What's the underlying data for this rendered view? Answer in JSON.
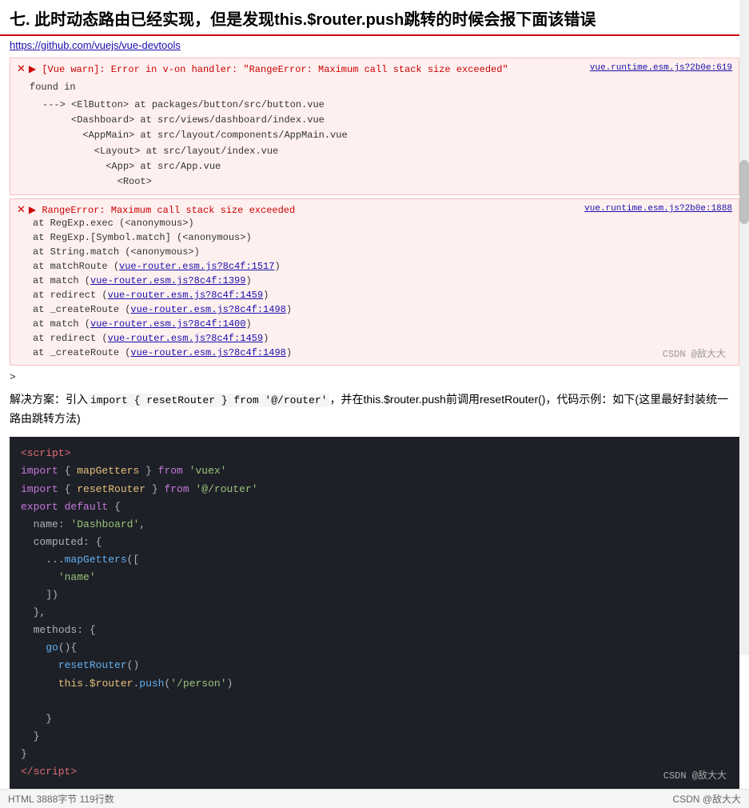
{
  "heading": "七. 此时动态路由已经实现，但是发现this.$router.push跳转的时候会报下面该错误",
  "url": "https://github.com/vuejs/vue-devtools",
  "error1": {
    "icon": "✕",
    "prefix": "▶",
    "message": "[Vue warn]: Error in v-on handler: \"RangeError: Maximum call stack size exceeded\"",
    "link_text": "vue.runtime.esm.js?2b0e:619",
    "found_in": "found in",
    "stack": [
      "---> <ElButton> at packages/button/src/button.vue",
      "      <Dashboard> at src/views/dashboard/index.vue",
      "        <AppMain> at src/layout/components/AppMain.vue",
      "          <Layout> at src/layout/index.vue",
      "            <App> at src/App.vue",
      "              <Root>"
    ]
  },
  "error2": {
    "icon": "✕",
    "prefix": "▶",
    "message": "RangeError: Maximum call stack size exceeded",
    "link_text": "vue.runtime.esm.js?2b0e:1888",
    "at_lines": [
      {
        "text": "at RegExp.exec (<anonymous>)"
      },
      {
        "text": "at RegExp.[Symbol.match] (<anonymous>)"
      },
      {
        "text": "at String.match (<anonymous>)"
      },
      {
        "text": "at matchRoute (",
        "link": "vue-router.esm.js?8c4f:1517",
        "close": ")"
      },
      {
        "text": "at match (",
        "link": "vue-router.esm.js?8c4f:1399",
        "close": ")"
      },
      {
        "text": "at redirect (",
        "link": "vue-router.esm.js?8c4f:1459",
        "close": ")"
      },
      {
        "text": "at _createRoute (",
        "link": "vue-router.esm.js?8c4f:1498",
        "close": ")"
      },
      {
        "text": "at match (",
        "link": "vue-router.esm.js?8c4f:1400",
        "close": ")"
      },
      {
        "text": "at redirect (",
        "link": "vue-router.esm.js?8c4f:1459",
        "close": ")"
      },
      {
        "text": "at _createRoute (",
        "link": "vue-router.esm.js?8c4f:1498",
        "close": ")"
      }
    ],
    "watermark": "CSDN @敌大大"
  },
  "more_indicator": ">",
  "solution": {
    "text_before": "解决方案：引入",
    "code_inline": "import { resetRouter } from '@/router'",
    "text_middle": "，并在this.$router.push前调用resetRouter()，代码示例：如下(这里最好封装统一路由跳转方法)",
    "label": "solution-text"
  },
  "code_block": {
    "watermark": "CSDN @敌大大",
    "lines": [
      "<script>",
      "import { mapGetters } from 'vuex'",
      "import { resetRouter } from '@/router'",
      "export default {",
      "  name: 'Dashboard',",
      "  computed: {",
      "    ...mapGetters([",
      "      'name'",
      "    ])",
      "  },",
      "  methods: {",
      "    go(){",
      "      resetRouter()",
      "      this.$router.push('/person')",
      "",
      "    }",
      "  }",
      "}",
      "<\\/script>"
    ]
  },
  "footer": {
    "left": "HTML 3888字节 119行数",
    "right": "CSDN @敌大大"
  }
}
